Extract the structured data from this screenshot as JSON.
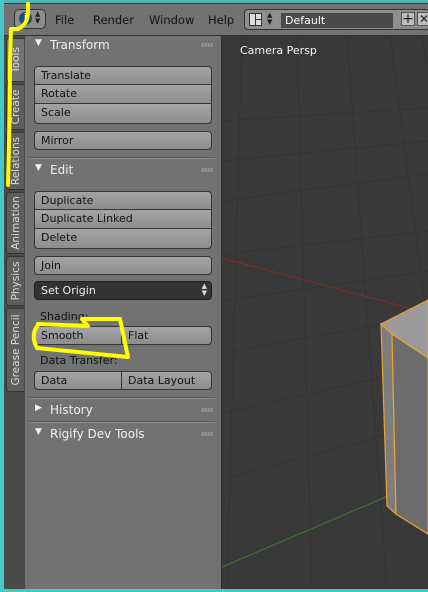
{
  "header": {
    "menus": [
      "File",
      "Render",
      "Window",
      "Help"
    ],
    "layout_name": "Default",
    "plus_symbol": "+",
    "close_symbol": "✕",
    "info_glyph": "i"
  },
  "tabs": [
    {
      "label": "Tools",
      "active": true
    },
    {
      "label": "Create",
      "active": false
    },
    {
      "label": "Relations",
      "active": false
    },
    {
      "label": "Animation",
      "active": false
    },
    {
      "label": "Physics",
      "active": false
    },
    {
      "label": "Grease Pencil",
      "active": false
    }
  ],
  "panels": {
    "transform": {
      "title": "Transform",
      "buttons": [
        "Translate",
        "Rotate",
        "Scale"
      ],
      "mirror": "Mirror"
    },
    "edit": {
      "title": "Edit",
      "buttons": [
        "Duplicate",
        "Duplicate Linked",
        "Delete"
      ],
      "join": "Join",
      "set_origin": "Set Origin",
      "shading_label": "Shading:",
      "smooth": "Smooth",
      "flat": "Flat",
      "data_transfer_label": "Data Transfer:",
      "data": "Data",
      "data_layout": "Data Layout"
    },
    "history": {
      "title": "History"
    },
    "rigify": {
      "title": "Rigify Dev Tools"
    }
  },
  "viewport": {
    "label": "Camera Persp"
  },
  "colors": {
    "annotation": "#ffff00",
    "selection_outline": "#f0a030",
    "window_border": "#45c8c6"
  }
}
